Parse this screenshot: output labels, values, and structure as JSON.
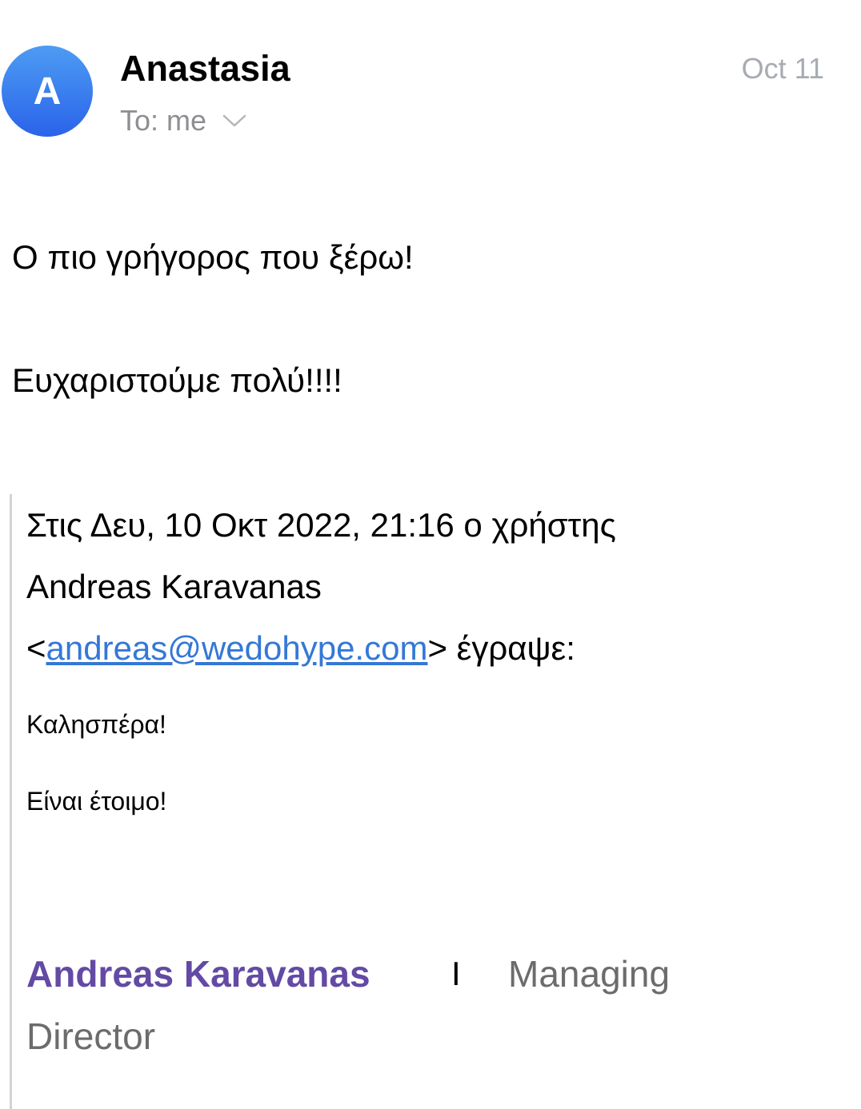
{
  "header": {
    "avatar_letter": "A",
    "sender_name": "Anastasia",
    "date": "Oct 11",
    "recipient": "To: me",
    "chevron_icon": "chevron-down-icon"
  },
  "message": {
    "line1": "Ο πιο γρήγορος που ξέρω!",
    "line2": "Ευχαριστούμε πολύ!!!!"
  },
  "quoted": {
    "header_line1": "Στις Δευ, 10 Οκτ 2022, 21:16 ο χρήστης",
    "header_line2": "Andreas Karavanas",
    "email_open": "<",
    "email": "andreas@wedohype.com",
    "email_close": "> έγραψε:",
    "greeting": "Καλησπέρα!",
    "ready": "Είναι έτοιμο!",
    "signature": {
      "name": "Andreas Karavanas",
      "separator": "I",
      "title_part1": "Managing",
      "title_part2": "Director"
    }
  },
  "colors": {
    "avatar_top": "#4d9cf3",
    "avatar_bottom": "#2a63ea",
    "link": "#3478d6",
    "signature_name": "#634aa4",
    "muted": "#8e8e93",
    "date": "#a7acb3"
  }
}
